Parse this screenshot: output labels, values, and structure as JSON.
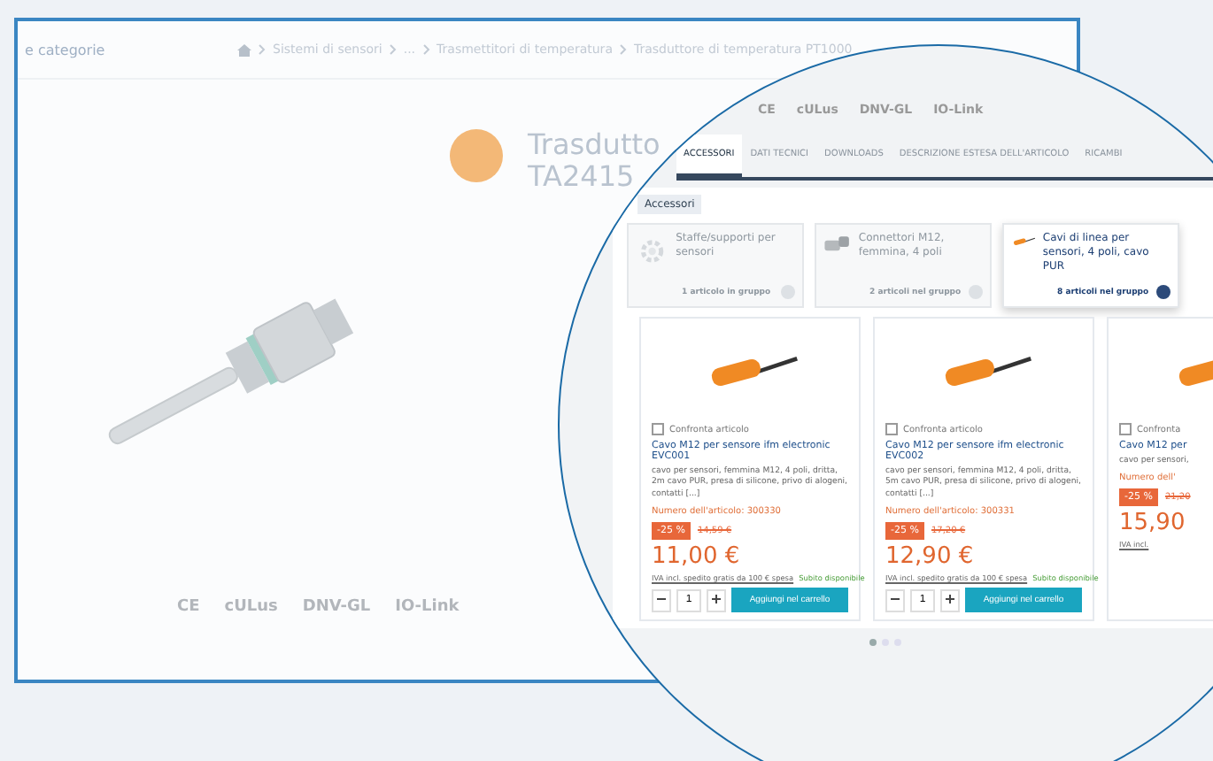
{
  "page": {
    "sidebar_title": "e categorie",
    "breadcrumb": [
      "Sistemi di sensori",
      "...",
      "Trasmettitori di temperatura",
      "Trasduttore di temperatura PT1000"
    ],
    "title_lines": [
      "Trasdutto",
      "TA2415"
    ],
    "certifications": [
      "CE",
      "cULus",
      "DNV-GL",
      "IO-Link"
    ]
  },
  "magnifier": {
    "certifications": [
      "CE",
      "cULus",
      "DNV-GL",
      "IO-Link"
    ],
    "tabs": [
      {
        "label": "ACCESSORI",
        "selected": true
      },
      {
        "label": "DATI TECNICI",
        "selected": false
      },
      {
        "label": "DOWNLOADS",
        "selected": false
      },
      {
        "label": "DESCRIZIONE ESTESA DELL'ARTICOLO",
        "selected": false
      },
      {
        "label": "RICAMBI",
        "selected": false
      }
    ],
    "section_label": "Accessori",
    "groups": [
      {
        "kind": "gear",
        "name": "Staffe/supporti per sensori",
        "count": "1 articolo in gruppo",
        "selected": false
      },
      {
        "kind": "connector",
        "name": "Connettori M12, femmina, 4 poli",
        "count": "2 articoli nel gruppo",
        "selected": false
      },
      {
        "kind": "cable",
        "name": "Cavi di linea per sensori, 4 poli, cavo PUR",
        "count": "8 articoli nel gruppo",
        "selected": true
      }
    ],
    "products": [
      {
        "compare": "Confronta articolo",
        "checked": false,
        "title": "Cavo M12 per sensore ifm electronic EVC001",
        "description": "cavo per sensori, femmina M12, 4 poli, dritta, 2m cavo PUR, presa di silicone, privo di alogeni, contatti [...]",
        "number": "Numero dell'articolo: 300330",
        "discount": "-25 %",
        "old_price": "14,59 €",
        "price": "11,00 €",
        "shipping": "IVA incl. spedito gratis da 100 € spesa",
        "stock": "Subito disponibile",
        "qty": "1",
        "button": "Aggiungi nel carrello"
      },
      {
        "compare": "Confronta articolo",
        "checked": false,
        "title": "Cavo M12 per sensore ifm electronic EVC002",
        "description": "cavo per sensori, femmina M12, 4 poli, dritta, 5m cavo PUR, presa di silicone, privo di alogeni, contatti [...]",
        "number": "Numero dell'articolo: 300331",
        "discount": "-25 %",
        "old_price": "17,20 €",
        "price": "12,90 €",
        "shipping": "IVA incl. spedito gratis da 100 € spesa",
        "stock": "Subito disponibile",
        "qty": "1",
        "button": "Aggiungi nel carrello"
      },
      {
        "compare": "Confronta",
        "checked": false,
        "title": "Cavo M12 per",
        "description": "cavo per sensori,",
        "number": "Numero dell'",
        "discount": "-25 %",
        "old_price": "21,20",
        "price": "15,90",
        "shipping": "IVA incl."
      }
    ],
    "pages": [
      {
        "selected": true
      },
      {
        "selected": false
      },
      {
        "selected": false
      }
    ]
  }
}
